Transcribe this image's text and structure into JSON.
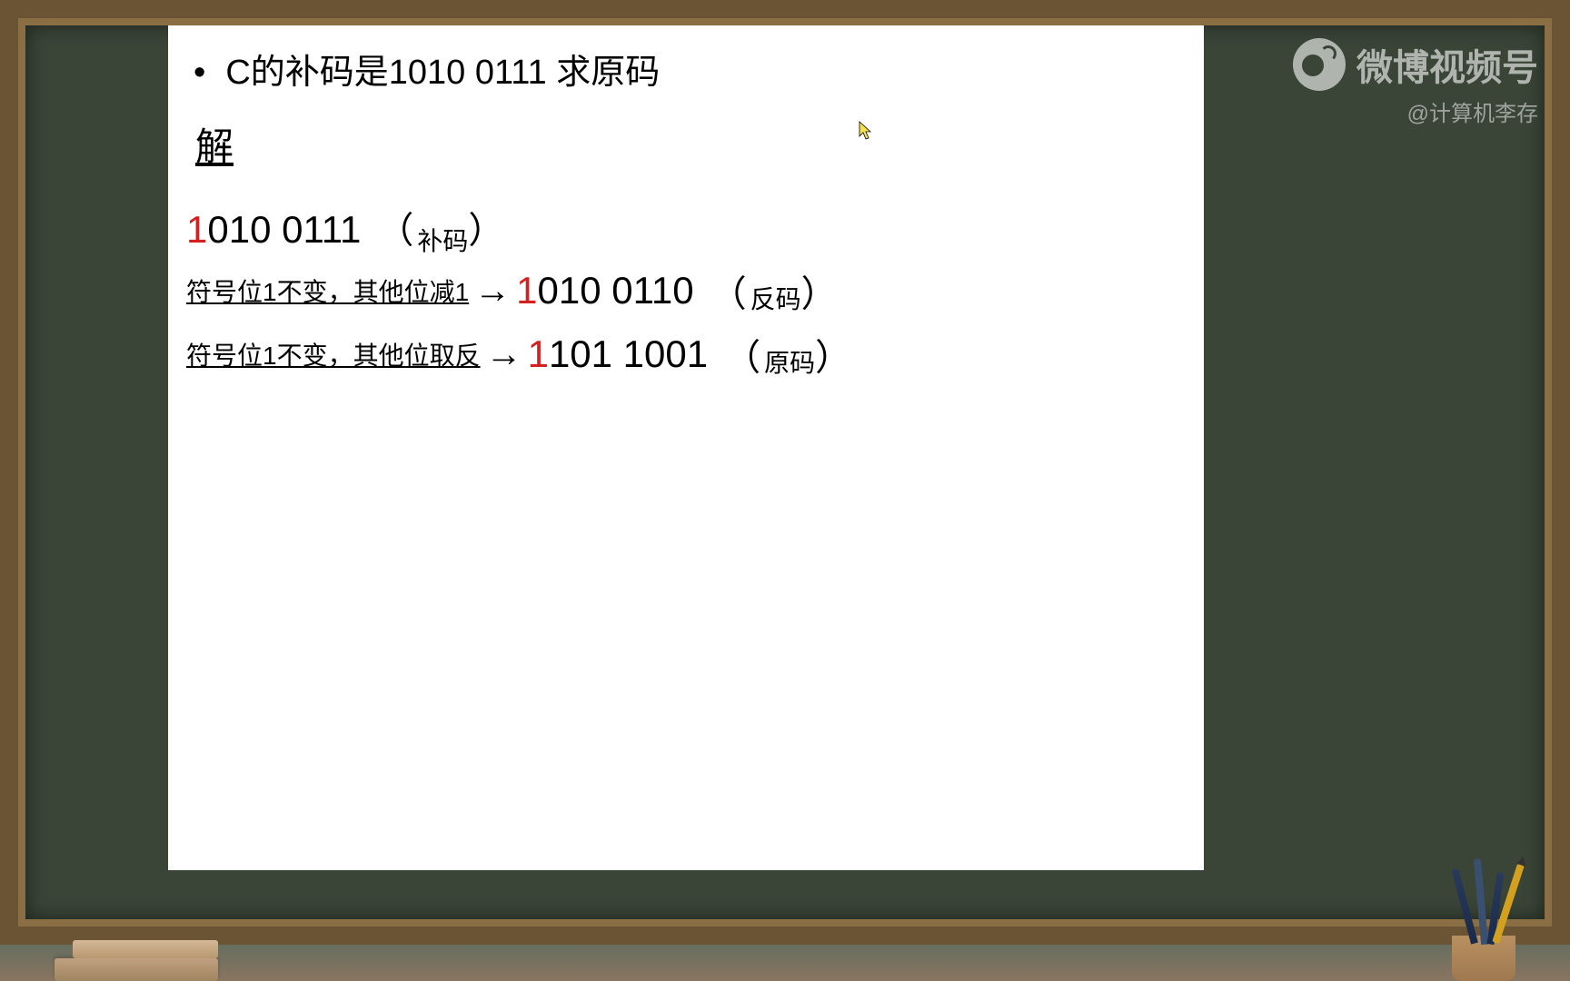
{
  "slide": {
    "bullet": "•",
    "question": "C的补码是1010 0111 求原码",
    "solution_label": "解",
    "line1": {
      "sign_bit": "1",
      "rest_bits": "010 0111",
      "paren_open": "（",
      "code_type": "补码",
      "paren_close": "）"
    },
    "line2": {
      "explanation": "符号位1不变，其他位减1",
      "arrow": "→",
      "sign_bit": "1",
      "rest_bits": "010 0110",
      "paren_open": "（",
      "code_type": "反码",
      "paren_close": "）"
    },
    "line3": {
      "explanation": "符号位1不变，其他位取反",
      "arrow": "→",
      "sign_bit": "1",
      "rest_bits": "101 1001",
      "paren_open": "（",
      "code_type": "原码",
      "paren_close": "）"
    }
  },
  "watermark": {
    "text": "微博视频号",
    "account": "@计算机李存"
  }
}
